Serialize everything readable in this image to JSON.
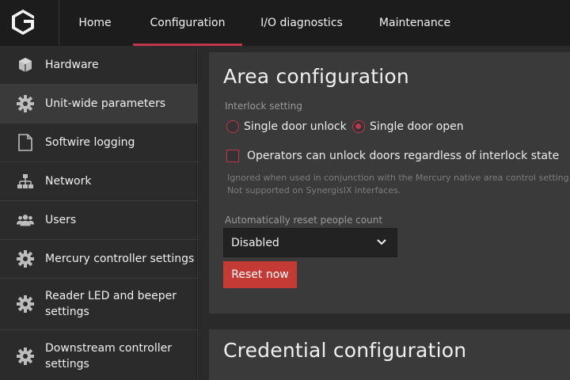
{
  "nav": {
    "items": [
      {
        "label": "Home",
        "active": false
      },
      {
        "label": "Configuration",
        "active": true
      },
      {
        "label": "I/O diagnostics",
        "active": false
      },
      {
        "label": "Maintenance",
        "active": false
      }
    ]
  },
  "sidebar": {
    "items": [
      {
        "label": "Hardware",
        "icon": "cube-icon"
      },
      {
        "label": "Unit-wide parameters",
        "icon": "gear-icon"
      },
      {
        "label": "Softwire logging",
        "icon": "document-icon"
      },
      {
        "label": "Network",
        "icon": "network-icon"
      },
      {
        "label": "Users",
        "icon": "users-icon"
      },
      {
        "label": "Mercury controller settings",
        "icon": "gear-icon"
      },
      {
        "label_line1": "Reader LED and beeper",
        "label_line2": "settings",
        "icon": "gear-icon"
      },
      {
        "label_line1": "Downstream controller",
        "label_line2": "settings",
        "icon": "gear-icon"
      }
    ]
  },
  "area": {
    "title": "Area configuration",
    "interlock_label": "Interlock setting",
    "radio_unlock": "Single door unlock",
    "radio_open": "Single door open",
    "selected": "Single door open",
    "checkbox_label": "Operators can unlock doors regardless of interlock state",
    "checkbox_checked": false,
    "hint_line1": "Ignored when used in conjunction with the Mercury native area control setting.",
    "hint_line2": "Not supported on SynergisIX interfaces.",
    "reset_label": "Automatically reset people count",
    "reset_value": "Disabled",
    "reset_button": "Reset now"
  },
  "credential": {
    "title": "Credential configuration"
  },
  "colors": {
    "accent": "#c0364a",
    "button": "#c43b36",
    "topbar": "#1c1c1c",
    "sidebar": "#2b2b2b",
    "card": "#3a3a3a"
  }
}
